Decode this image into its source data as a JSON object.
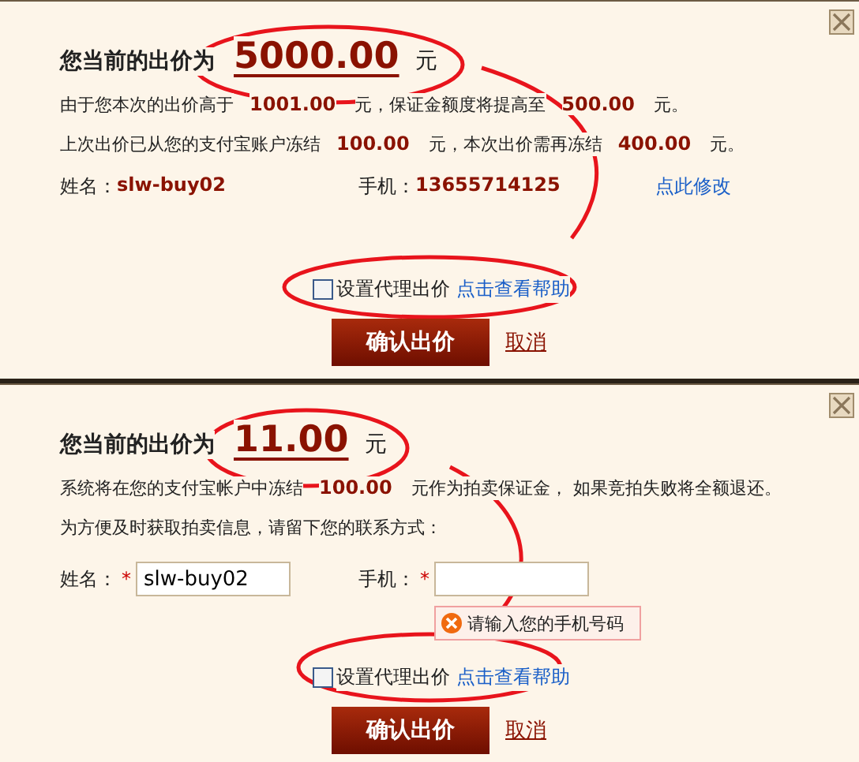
{
  "dialogs": [
    {
      "title": "您当前的出价为",
      "amount": "5000.00",
      "unit": "元",
      "lines": [
        [
          {
            "kind": "text",
            "text": "由于您本次的出价高于"
          },
          {
            "kind": "amount",
            "text": "1001.00"
          },
          {
            "kind": "text",
            "text": "元，保证金额度将提高至"
          },
          {
            "kind": "amount",
            "text": "500.00"
          },
          {
            "kind": "text",
            "text": "元。"
          }
        ],
        [
          {
            "kind": "text",
            "text": "上次出价已从您的支付宝账户冻结"
          },
          {
            "kind": "amount",
            "text": "100.00"
          },
          {
            "kind": "text",
            "text": "元，本次出价需再冻结"
          },
          {
            "kind": "amount",
            "text": "400.00"
          },
          {
            "kind": "text",
            "text": "元。"
          }
        ]
      ],
      "contact": {
        "kind": "readonly",
        "name_label": "姓名：",
        "name": "slw-buy02",
        "phone_label": "手机：",
        "phone": "13655714125",
        "edit_link": "点此修改"
      },
      "proxy": {
        "checked": false,
        "label": "设置代理出价",
        "help_link": "点击查看帮助"
      },
      "confirm_button": "确认出价",
      "cancel_link": "取消"
    },
    {
      "title": "您当前的出价为",
      "amount": "11.00",
      "unit": "元",
      "lines": [
        [
          {
            "kind": "text",
            "text": "系统将在您的支付宝帐户中冻结"
          },
          {
            "kind": "amount",
            "text": "100.00"
          },
          {
            "kind": "text",
            "text": "元作为拍卖保证金， 如果竞拍失败将全额退还。"
          }
        ],
        [
          {
            "kind": "text",
            "text": "为方便及时获取拍卖信息，请留下您的联系方式："
          }
        ]
      ],
      "contact": {
        "kind": "form",
        "name_label": "姓名：",
        "required_mark": "*",
        "name": "slw-buy02",
        "phone_label": "手机：",
        "error": "请输入您的手机号码"
      },
      "proxy": {
        "checked": false,
        "label": "设置代理出价",
        "help_link": "点击查看帮助"
      },
      "confirm_button": "确认出价",
      "cancel_link": "取消"
    }
  ]
}
